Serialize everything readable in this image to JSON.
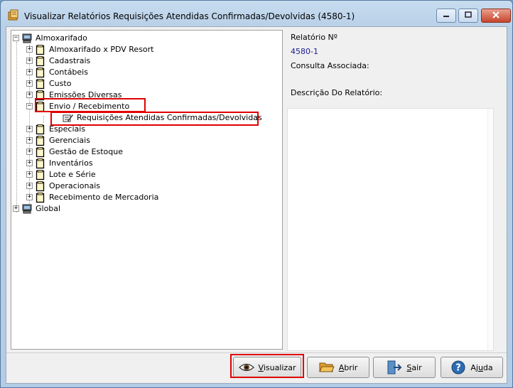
{
  "window": {
    "title": "Visualizar Relatórios Requisições Atendidas Confirmadas/Devolvidas (4580-1)",
    "icons": {
      "app": "folder-report-icon",
      "minimize": "minimize-icon",
      "maximize": "maximize-icon",
      "close": "close-icon"
    }
  },
  "tree": {
    "root1": {
      "label": "Almoxarifado",
      "expander": "⊟",
      "icon": "computer-icon"
    },
    "children": [
      {
        "label": "Almoxarifado x PDV Resort"
      },
      {
        "label": "Cadastrais"
      },
      {
        "label": "Contábeis"
      },
      {
        "label": "Custo"
      },
      {
        "label": "Emissões Diversas"
      },
      {
        "label": "Envio / Recebimento",
        "expanded": true
      },
      {
        "label": "Especiais"
      },
      {
        "label": "Gerenciais"
      },
      {
        "label": "Gestão de Estoque"
      },
      {
        "label": "Inventários"
      },
      {
        "label": "Lote e Série"
      },
      {
        "label": "Operacionais"
      },
      {
        "label": "Recebimento de Mercadoria"
      }
    ],
    "leaf": {
      "label": "Requisições Atendidas Confirmadas/Devolvidas",
      "icon": "report-pencil-icon"
    },
    "root2": {
      "label": "Global",
      "icon": "computer-icon"
    }
  },
  "info": {
    "relatorio_label": "Relatório Nº",
    "relatorio_value": "4580-1",
    "consulta_label": "Consulta Associada:",
    "descricao_label": "Descrição Do Relatório:"
  },
  "buttons": {
    "visualizar": {
      "pre": "",
      "key": "V",
      "post": "isualizar",
      "icon": "eye-icon"
    },
    "abrir": {
      "pre": "",
      "key": "A",
      "post": "brir",
      "icon": "folder-open-icon"
    },
    "sair": {
      "pre": "",
      "key": "S",
      "post": "air",
      "icon": "exit-door-icon"
    },
    "ajuda": {
      "pre": "Aj",
      "key": "u",
      "post": "da",
      "icon": "help-icon"
    }
  },
  "colors": {
    "highlight": "#e00000",
    "value_text": "#1a1a8c"
  }
}
